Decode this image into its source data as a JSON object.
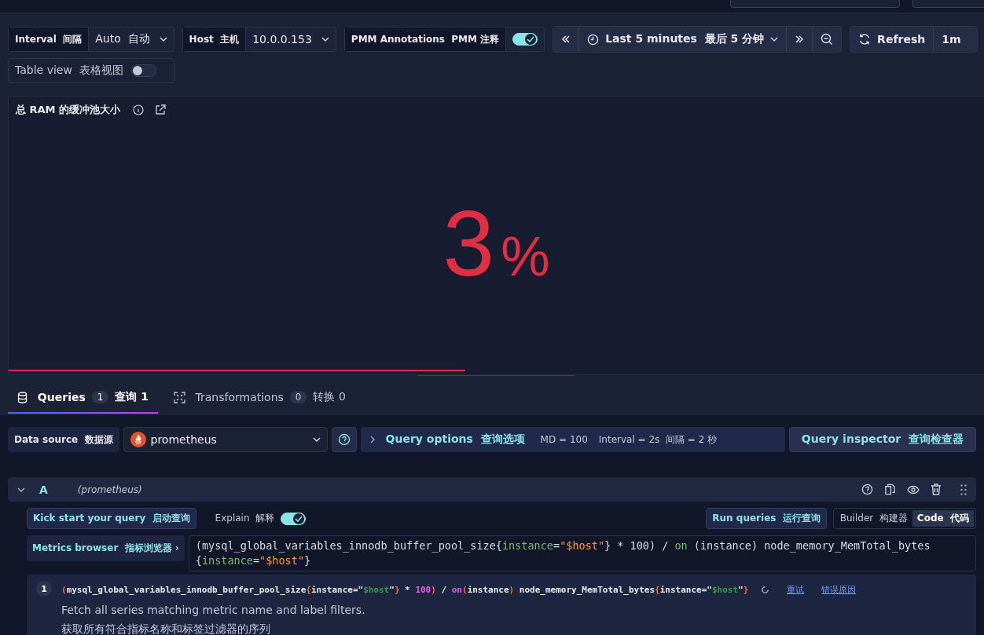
{
  "variables": [
    {
      "label": "Interval  间隔",
      "value": "Auto  自动",
      "kind": "select"
    },
    {
      "label": "Host  主机",
      "value": "10.0.0.153",
      "kind": "select"
    },
    {
      "label": "PMM Annotations  PMM 注释",
      "on": true,
      "kind": "switch"
    }
  ],
  "table_view": {
    "label": "Table view  表格视图",
    "on": false
  },
  "time_picker": {
    "range": "Last 5 minutes  最后 5 分钟",
    "refresh": "Refresh",
    "refresh_interval": "1m"
  },
  "panel": {
    "title": "总 RAM 的缓冲池大小",
    "value": "3",
    "unit": "%"
  },
  "tabs": [
    {
      "label": "Queries",
      "count": "1",
      "extra": "查询 1",
      "selected": true
    },
    {
      "label": "Transformations",
      "count": "0",
      "extra": "转换 0",
      "selected": false
    }
  ],
  "data_source": {
    "label": "Data source  数据源",
    "value": "prometheus"
  },
  "query_options": {
    "label": "Query options  查询选项",
    "md": "MD = 100",
    "interval": "Interval = 2s  间隔 = 2 秒"
  },
  "query_inspector": "Query inspector  查询检查器",
  "query": {
    "ref": "A",
    "source": "(prometheus)",
    "expanded": true,
    "kick_start": "Kick start your query  启动查询",
    "explain": {
      "label": "Explain  解释",
      "on": true
    },
    "run": "Run queries  运行查询",
    "modes": [
      {
        "label": "Builder  构建器",
        "selected": false
      },
      {
        "label": "Code  代码",
        "selected": true
      }
    ],
    "metrics_browser": "Metrics browser  指标浏览器 ›",
    "editor_tokens": [
      {
        "text": "(mysql_global_variables_innodb_buffer_pool_size",
        "kind": "plain"
      },
      {
        "text": "{",
        "kind": "plain"
      },
      {
        "text": "instance",
        "kind": "label"
      },
      {
        "text": "=",
        "kind": "plain"
      },
      {
        "text": "\"$host\"",
        "kind": "string"
      },
      {
        "text": "} * 100) / ",
        "kind": "plain"
      },
      {
        "text": "on",
        "kind": "keyword"
      },
      {
        "text": " (instance) node_memory_MemTotal_bytes",
        "kind": "plain"
      },
      {
        "text": "{",
        "kind": "break"
      },
      {
        "text": "instance",
        "kind": "label"
      },
      {
        "text": "=",
        "kind": "plain"
      },
      {
        "text": "\"$host\"",
        "kind": "string"
      },
      {
        "text": "}",
        "kind": "plain"
      }
    ],
    "explain_step": {
      "number": "1",
      "tokens": [
        {
          "text": "(",
          "kind": "paren"
        },
        {
          "text": "mysql_global_variables_innodb_buffer_pool_size",
          "kind": "plain"
        },
        {
          "text": "{",
          "kind": "paren"
        },
        {
          "text": "instance",
          "kind": "plain"
        },
        {
          "text": "=\"",
          "kind": "plain"
        },
        {
          "text": "$host",
          "kind": "string"
        },
        {
          "text": "\"",
          "kind": "plain"
        },
        {
          "text": "}",
          "kind": "paren"
        },
        {
          "text": " * ",
          "kind": "plain"
        },
        {
          "text": "100",
          "kind": "number"
        },
        {
          "text": ")",
          "kind": "paren"
        },
        {
          "text": " / ",
          "kind": "plain"
        },
        {
          "text": "on",
          "kind": "keyword"
        },
        {
          "text": "(",
          "kind": "paren"
        },
        {
          "text": "instance",
          "kind": "plain"
        },
        {
          "text": ")",
          "kind": "paren"
        },
        {
          "text": " node_memory_MemTotal_bytes",
          "kind": "plain"
        },
        {
          "text": "{",
          "kind": "paren"
        },
        {
          "text": "instance",
          "kind": "plain"
        },
        {
          "text": "=\"",
          "kind": "plain"
        },
        {
          "text": "$host",
          "kind": "string"
        },
        {
          "text": "\"",
          "kind": "plain"
        },
        {
          "text": "}",
          "kind": "paren"
        }
      ],
      "retry": "重试",
      "error_reason": "错误原因",
      "description": "Fetch all series matching metric name and label filters.",
      "description_zh": "获取所有符合指标名称和标签过滤器的序列"
    }
  }
}
